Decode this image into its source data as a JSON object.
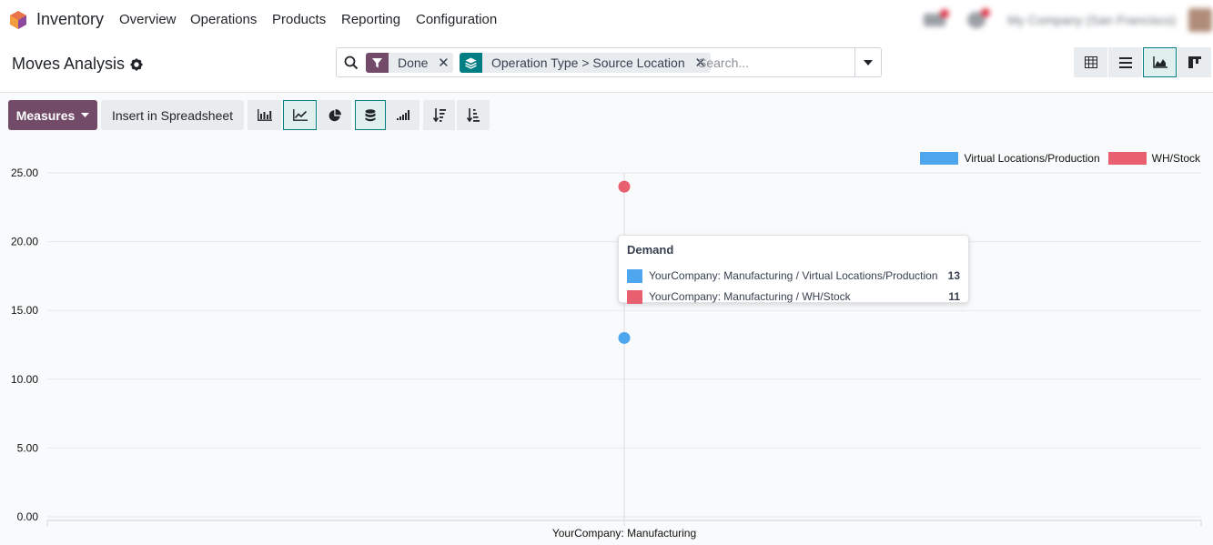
{
  "app": {
    "name": "Inventory",
    "menu": [
      "Overview",
      "Operations",
      "Products",
      "Reporting",
      "Configuration"
    ],
    "company_user": "My Company (San Francisco)"
  },
  "control_panel": {
    "title": "Moves Analysis",
    "search": {
      "facets": [
        {
          "icon": "filter-icon",
          "label": "Done"
        },
        {
          "icon": "layers-icon",
          "label": "Operation Type > Source Location"
        }
      ],
      "placeholder": "Search..."
    },
    "views": [
      "pivot-view-icon",
      "list-view-icon",
      "graph-view-icon",
      "kanban-view-icon"
    ],
    "active_view": "graph"
  },
  "toolbar": {
    "measures_label": "Measures",
    "insert_label": "Insert in Spreadsheet",
    "chart_type_buttons": [
      "bar-chart-icon",
      "line-chart-icon",
      "pie-chart-icon"
    ],
    "active_chart_type": "line",
    "option_buttons": [
      "stacked-icon",
      "cumulative-icon",
      "sort-descending-icon",
      "sort-ascending-icon"
    ]
  },
  "chart_data": {
    "type": "line",
    "categories": [
      "YourCompany: Manufacturing"
    ],
    "series": [
      {
        "name": "Virtual Locations/Production",
        "values": [
          13
        ],
        "color": "#4ea6ef"
      },
      {
        "name": "WH/Stock",
        "values": [
          24
        ],
        "color": "#e8606f"
      }
    ],
    "ylim": [
      0,
      25
    ],
    "yticks": [
      "0.00",
      "5.00",
      "10.00",
      "15.00",
      "20.00",
      "25.00"
    ],
    "grid": true,
    "legend": "top-right"
  },
  "tooltip": {
    "title": "Demand",
    "rows": [
      {
        "label": "YourCompany: Manufacturing / Virtual Locations/Production",
        "value": "13",
        "color": "#4ea6ef"
      },
      {
        "label": "YourCompany: Manufacturing / WH/Stock",
        "value": "11",
        "color": "#e8606f"
      }
    ]
  },
  "colors": {
    "brand": "#714b67",
    "accent": "#017e84"
  }
}
